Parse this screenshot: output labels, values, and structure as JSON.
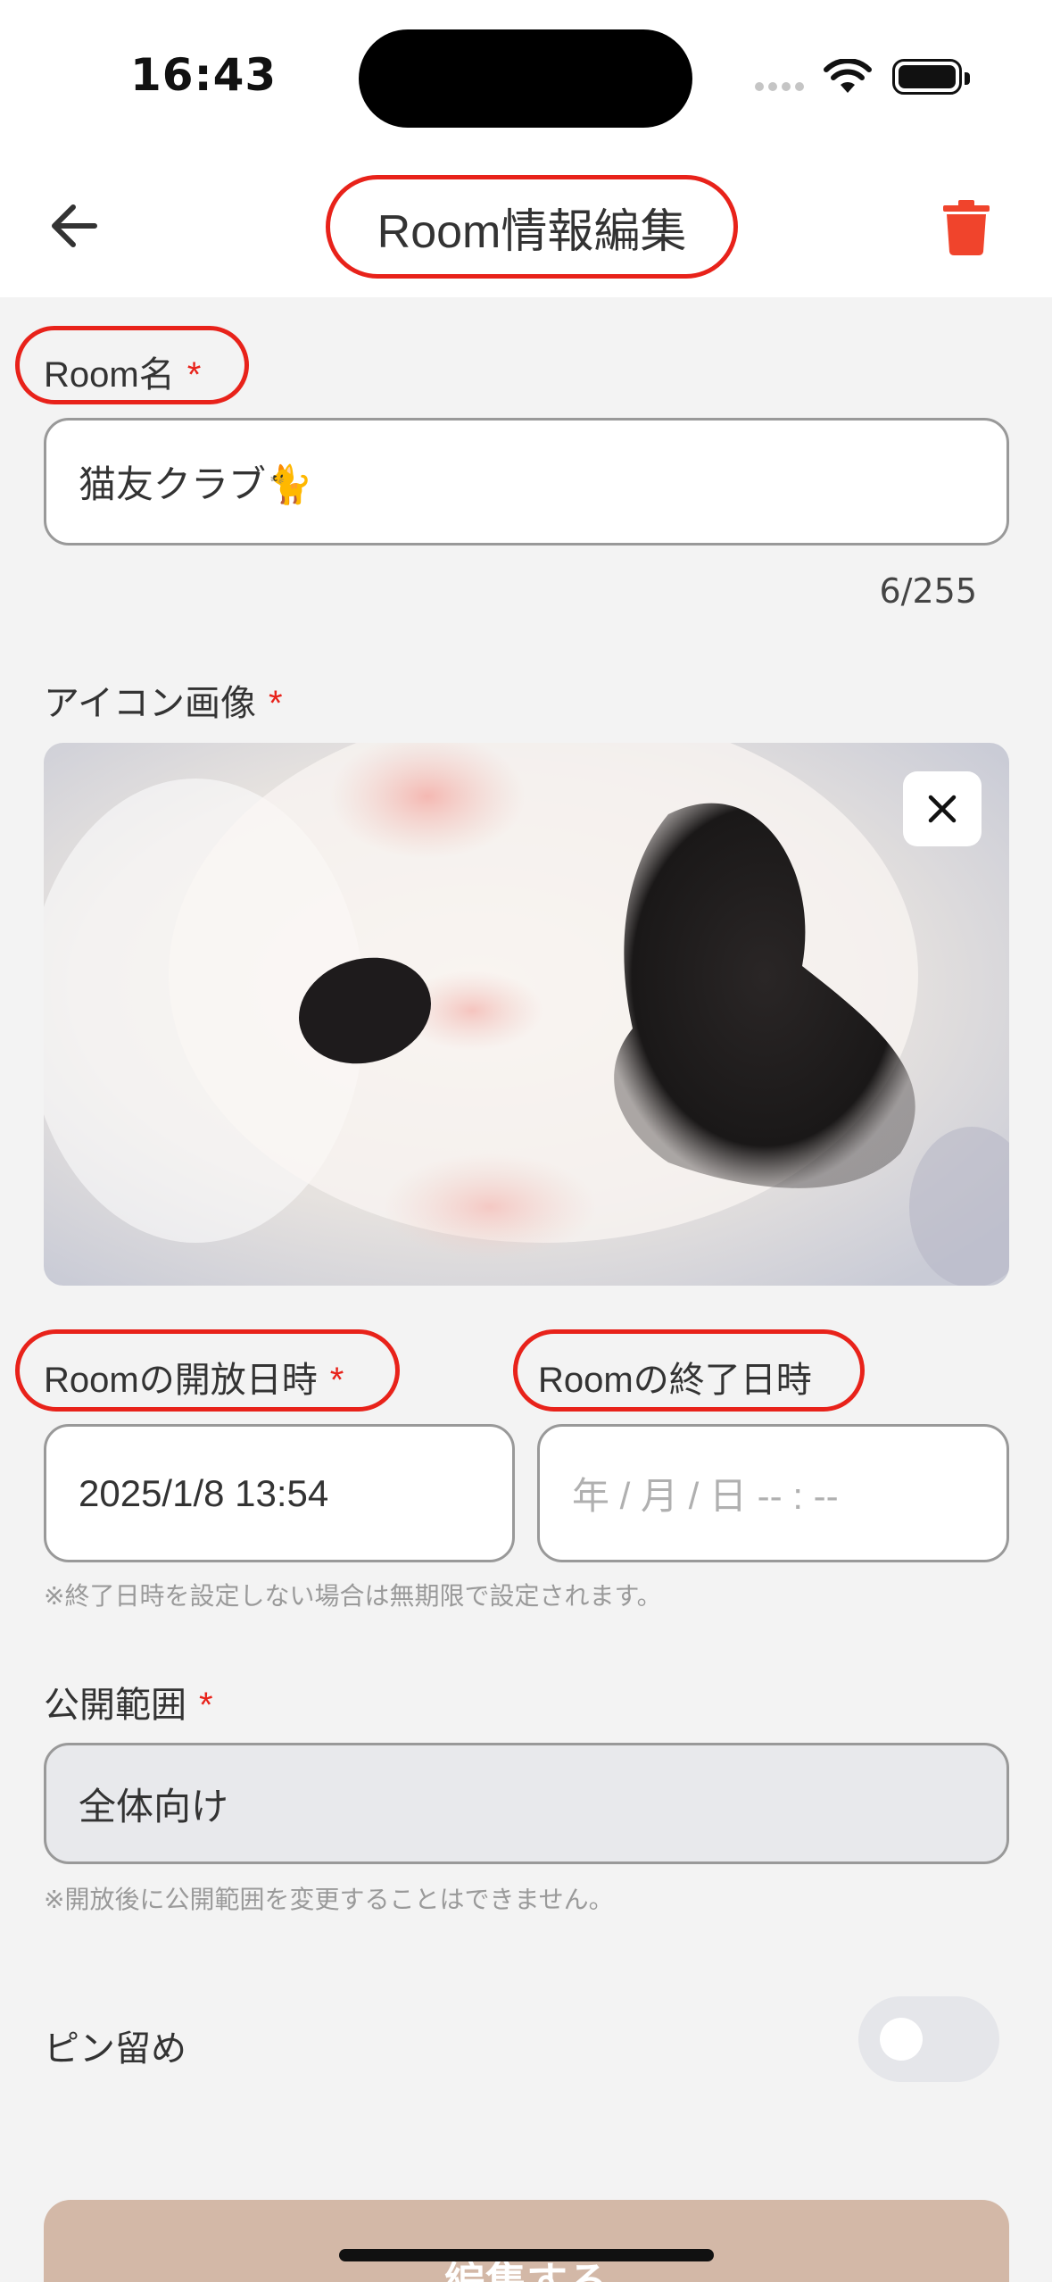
{
  "status_bar": {
    "time": "16:43"
  },
  "header": {
    "title": "Room情報編集"
  },
  "room_name": {
    "label": "Room名",
    "required_mark": "*",
    "value": "猫友クラブ🐈",
    "counter": "6/255"
  },
  "icon_image": {
    "label": "アイコン画像",
    "required_mark": "*"
  },
  "open_datetime": {
    "label": "Roomの開放日時",
    "required_mark": "*",
    "value": "2025/1/8 13:54"
  },
  "end_datetime": {
    "label": "Roomの終了日時",
    "placeholder": "年 / 月 / 日 -- : --"
  },
  "end_note": "※終了日時を設定しない場合は無期限で設定されます。",
  "visibility": {
    "label": "公開範囲",
    "required_mark": "*",
    "value": "全体向け",
    "note": "※開放後に公開範囲を変更することはできません。"
  },
  "pin": {
    "label": "ピン留め",
    "enabled": false
  },
  "submit": {
    "label": "編集する"
  },
  "colors": {
    "accent_red": "#e8221a",
    "delete_icon": "#f0442c",
    "submit_button": "#d3b8a7",
    "background": "#f3f3f3"
  },
  "icons": [
    "back-arrow-icon",
    "trash-icon",
    "close-icon",
    "wifi-icon",
    "battery-icon",
    "cellular-signal-icon"
  ]
}
